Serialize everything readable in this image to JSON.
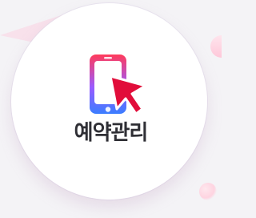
{
  "menu_card": {
    "title": "예약관리",
    "icon": "phone-tap-icon",
    "colors": {
      "phone_top": "#ff3b5b",
      "phone_bottom": "#3a7dff",
      "pointer": "#e10d3a",
      "background": "#f4f3f6",
      "card": "#ffffff",
      "title": "#2f2f35"
    }
  }
}
